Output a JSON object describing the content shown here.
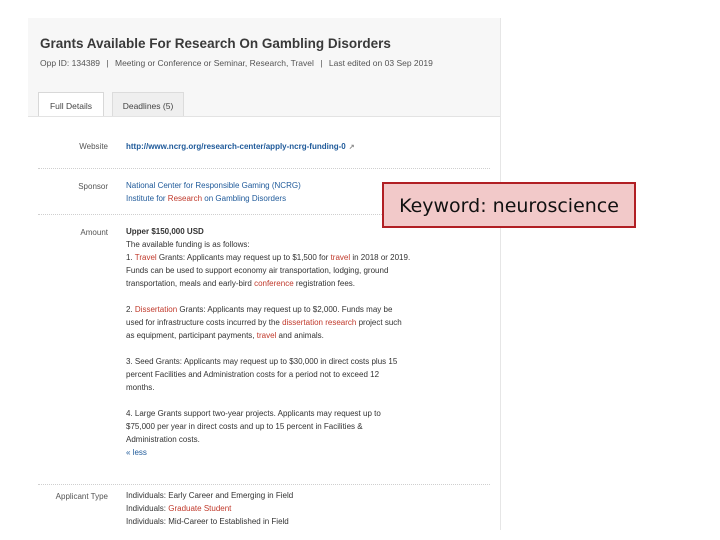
{
  "header": {
    "title": "Grants Available For Research On Gambling Disorders",
    "opp_id": "Opp ID: 134389",
    "categories": "Meeting or Conference or Seminar, Research, Travel",
    "last_edited": "Last edited on 03 Sep 2019",
    "separator": "|"
  },
  "tabs": [
    {
      "label": "Full Details",
      "active": true
    },
    {
      "label": "Deadlines (5)",
      "active": false
    }
  ],
  "website": {
    "label": "Website",
    "url": "http://www.ncrg.org/research-center/apply-ncrg-funding-0",
    "icon": "external-link-icon"
  },
  "sponsor": {
    "label": "Sponsor",
    "line1": "National Center for Responsible Gaming (NCRG)",
    "line2_pre": "Institute for ",
    "line2_kw": "Research",
    "line2_post": " on Gambling Disorders"
  },
  "amount": {
    "label": "Amount",
    "upper": "Upper  $150,000 USD",
    "intro": "The available funding is as follows:",
    "p1": {
      "num": "1. ",
      "kw1": "Travel",
      "t1": " Grants: Applicants may request up to $1,500 for ",
      "kw2": "travel",
      "t2": " in 2018 or 2019.",
      "l2": "Funds can be used to support economy air transportation, lodging, ground",
      "l3_pre": "transportation, meals and early-bird ",
      "l3_kw": "conference",
      "l3_post": " registration fees."
    },
    "p2": {
      "num": "2. ",
      "kw1": "Dissertation",
      "t1": " Grants: Applicants may request up to $2,000. Funds may be",
      "l2_pre": "used for infrastructure costs incurred by the ",
      "l2_kw1": "dissertation",
      "l2_sp": " ",
      "l2_kw2": "research",
      "l2_post": " project such",
      "l3_pre": "as equipment, participant payments, ",
      "l3_kw": "travel",
      "l3_post": " and animals."
    },
    "p3": {
      "l1": "3. Seed Grants: Applicants may request up to $30,000 in direct costs plus 15",
      "l2": "percent Facilities and Administration costs for a period not to exceed 12",
      "l3": "months."
    },
    "p4": {
      "l1": "4. Large Grants support two-year projects. Applicants may request up to",
      "l2": "$75,000 per year in direct costs and up to 15 percent in Facilities &",
      "l3": "Administration costs."
    },
    "less": "« less"
  },
  "applicant_type": {
    "label": "Applicant Type",
    "l1": "Individuals: Early Career and Emerging in Field",
    "l2_pre": "Individuals: ",
    "l2_kw": "Graduate Student",
    "l3": "Individuals: Mid-Career to Established in Field"
  },
  "overlay": {
    "keyword_label": "Keyword: neuroscience"
  },
  "colors": {
    "link": "#1f5a9a",
    "keyword_highlight": "#c0392b",
    "overlay_fill": "#f2c9c9",
    "overlay_border": "#b11f24"
  }
}
